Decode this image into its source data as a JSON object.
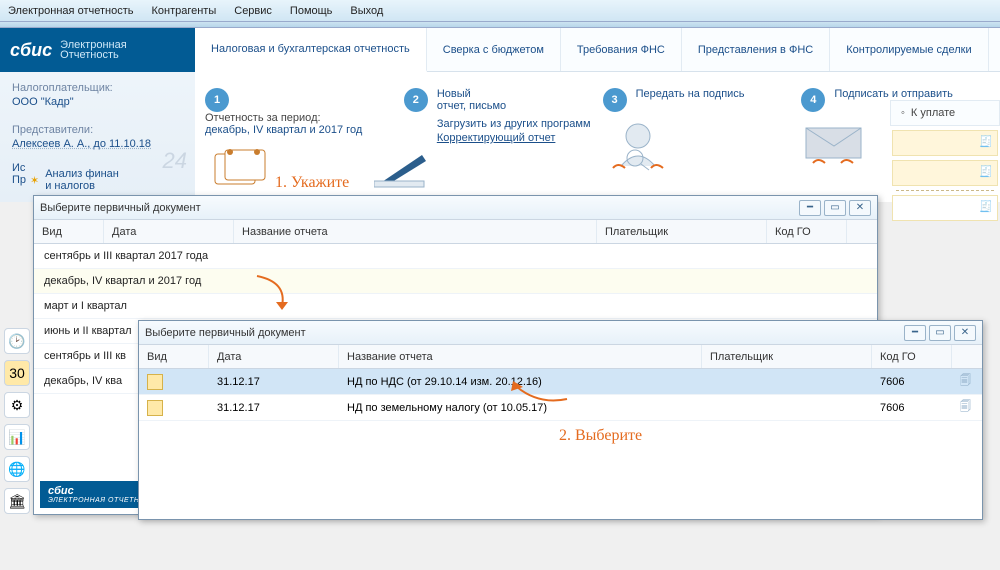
{
  "menu": [
    "Электронная отчетность",
    "Контрагенты",
    "Сервис",
    "Помощь",
    "Выход"
  ],
  "logo": {
    "word": "сбис",
    "sub1": "Электронная",
    "sub2": "Отчетность"
  },
  "sidebar": {
    "payer_label": "Налогоплательщик:",
    "payer": "ООО \"Кадр\"",
    "reps_label": "Представители:",
    "rep": "Алексеев А. А., до 11.10.18",
    "watermark": "24",
    "trunc1": "Ис",
    "trunc2": "Пр",
    "analysis": "Анализ финан \nи налогов"
  },
  "tabs": [
    "Налоговая и бухгалтерская отчетность",
    "Сверка с бюджетом",
    "Требования ФНС",
    "Представления в ФНС",
    "Контролируемые сделки"
  ],
  "wizard": {
    "s1": {
      "title": "Отчетность за период:",
      "link": "декабрь, IV квартал и 2017 год"
    },
    "s2": {
      "t1": "Новый",
      "t2": "отчет, письмо",
      "t3": "Загрузить из других программ",
      "t4": "Корректирующий отчет"
    },
    "s3": {
      "t": "Передать на подпись"
    },
    "s4": {
      "t": "Подписать и отправить"
    }
  },
  "hand1": "1. Укажите",
  "hand2": "2. Выберите",
  "right": {
    "tab": "К уплате"
  },
  "modal": {
    "title": "Выберите первичный документ",
    "cols": {
      "vid": "Вид",
      "date": "Дата",
      "name": "Название отчета",
      "payer": "Плательщик",
      "code": "Код ГО"
    }
  },
  "periods": [
    "сентябрь и III квартал 2017 года",
    "декабрь, IV квартал и 2017 год",
    "март и I квартал",
    "июнь и II квартал",
    "сентябрь и III кв",
    "декабрь, IV ква"
  ],
  "rows": [
    {
      "date": "31.12.17",
      "name": "НД по НДС (от 29.10.14 изм. 20.12.16)",
      "code": "7606"
    },
    {
      "date": "31.12.17",
      "name": "НД по земельному налогу (от 10.05.17)",
      "code": "7606"
    }
  ],
  "logo2": {
    "word": "сбис",
    "sub": "ЭЛЕКТРОННАЯ ОТЧЕТН"
  }
}
